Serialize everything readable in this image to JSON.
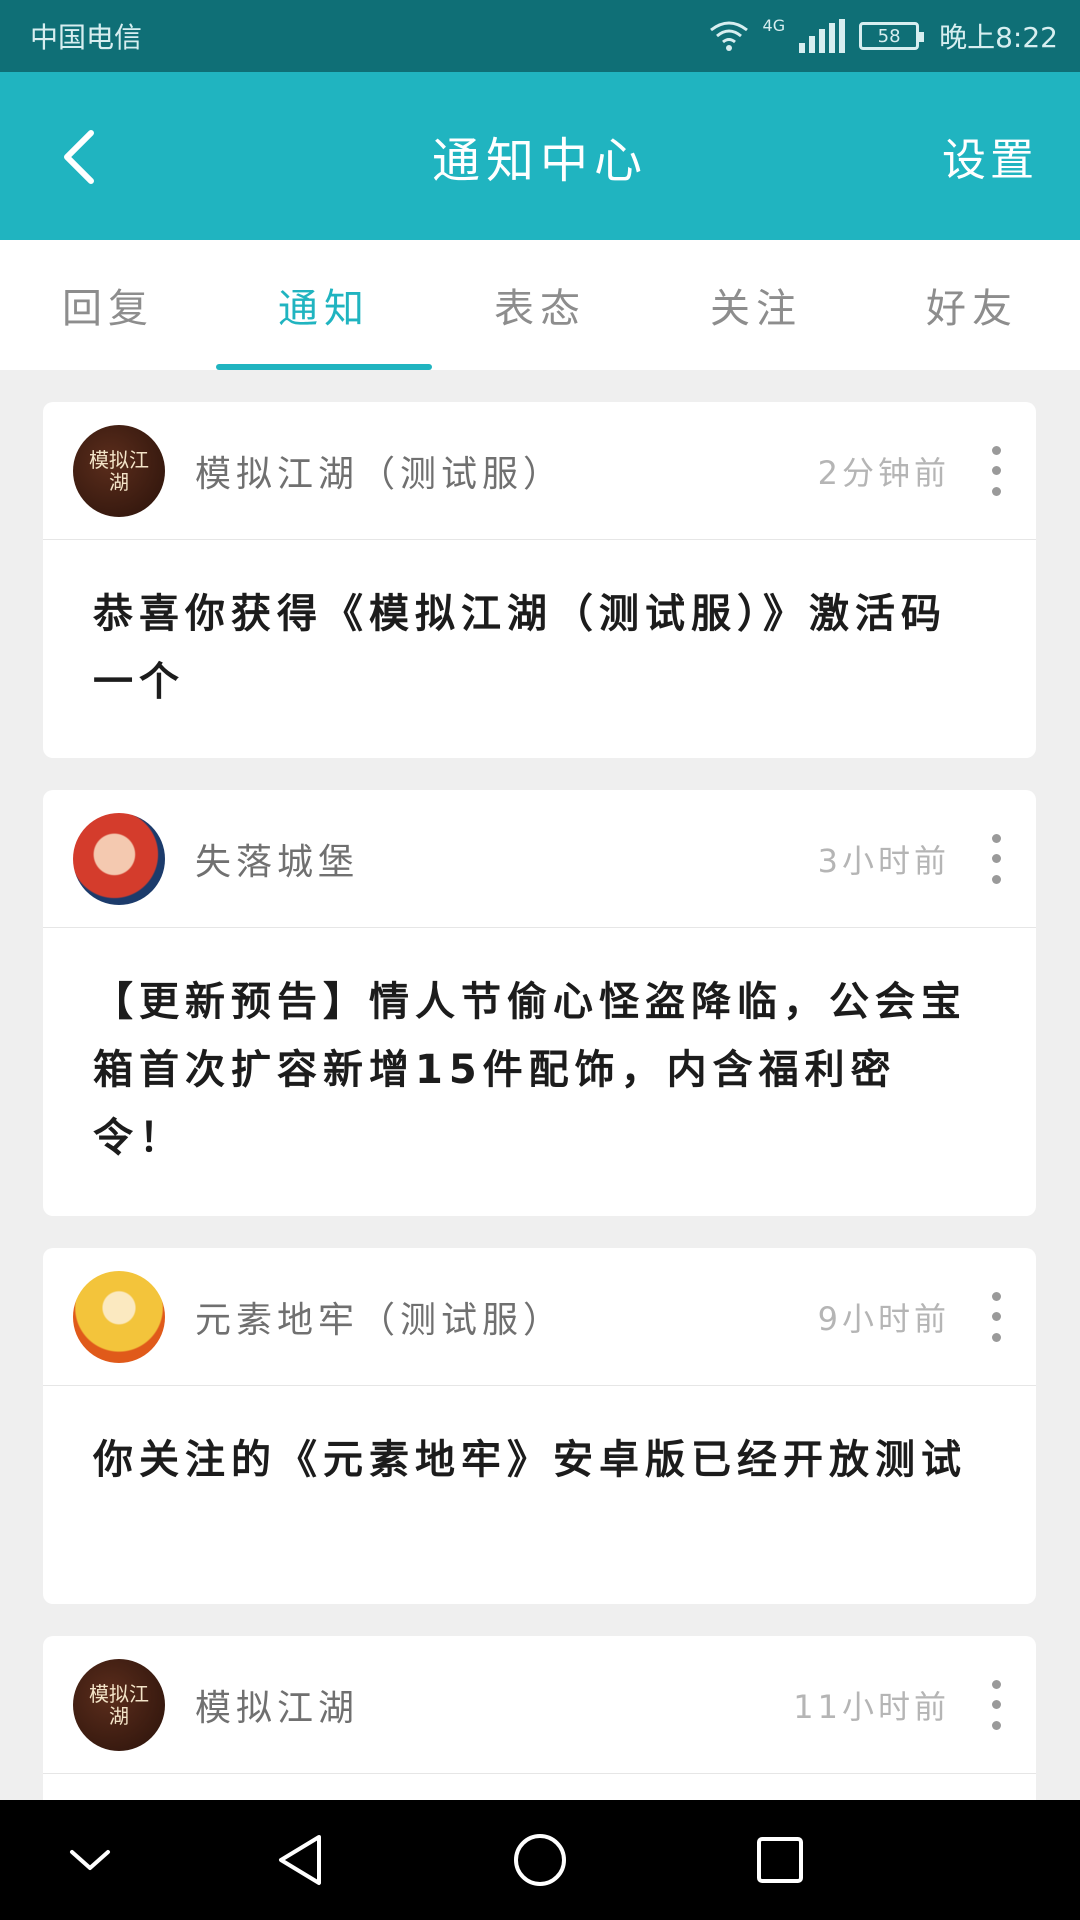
{
  "statusbar": {
    "carrier": "中国电信",
    "network": "4G",
    "battery": "58",
    "time": "晚上8:22"
  },
  "appbar": {
    "title": "通知中心",
    "settings_label": "设置"
  },
  "tabs": [
    {
      "label": "回复",
      "active": false
    },
    {
      "label": "通知",
      "active": true
    },
    {
      "label": "表态",
      "active": false
    },
    {
      "label": "关注",
      "active": false
    },
    {
      "label": "好友",
      "active": false
    }
  ],
  "notifications": [
    {
      "app": "模拟江湖（测试服）",
      "time": "2分钟前",
      "message": "恭喜你获得《模拟江湖（测试服）》激活码一个",
      "avatar_icon": "moni-jianghu-logo-icon",
      "avatar_text": "模拟江湖"
    },
    {
      "app": "失落城堡",
      "time": "3小时前",
      "message": "【更新预告】情人节偷心怪盗降临，公会宝箱首次扩容新增15件配饰，内含福利密令！",
      "avatar_icon": "lost-castle-logo-icon"
    },
    {
      "app": "元素地牢（测试服）",
      "time": "9小时前",
      "message": "你关注的《元素地牢》安卓版已经开放测试",
      "avatar_icon": "element-dungeon-logo-icon"
    },
    {
      "app": "模拟江湖",
      "time": "11小时前",
      "message": "",
      "avatar_icon": "moni-jianghu-logo-icon",
      "avatar_text": "模拟江湖"
    }
  ]
}
